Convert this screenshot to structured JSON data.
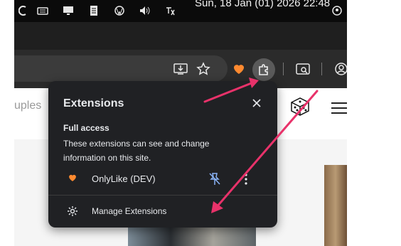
{
  "menubar": {
    "clock": "Sun, 18 Jan (01) 2026 22:48",
    "icons": [
      "app-icon",
      "keyboard-icon",
      "display-icon",
      "clipboard-icon",
      "wordpress-icon",
      "volume-icon",
      "translate-icon",
      "user-icon"
    ]
  },
  "toolbar": {
    "icons": [
      "install-icon",
      "bookmark-star-icon",
      "onlylike-extension-icon",
      "extensions-puzzle-icon",
      "tab-search-icon",
      "profile-icon"
    ]
  },
  "page": {
    "partial_text": "uples"
  },
  "popup": {
    "title": "Extensions",
    "section_heading": "Full access",
    "section_description": "These extensions can see and change information on this site.",
    "extensions": [
      {
        "name": "OnlyLike (DEV)",
        "icon": "heart-icon",
        "pinned": true
      }
    ],
    "manage_label": "Manage Extensions"
  },
  "colors": {
    "popup_bg": "#202124",
    "pin_blue": "#8ab4f8",
    "annotation_arrow": "#e8326a",
    "extension_heart": "#ff8a30"
  }
}
